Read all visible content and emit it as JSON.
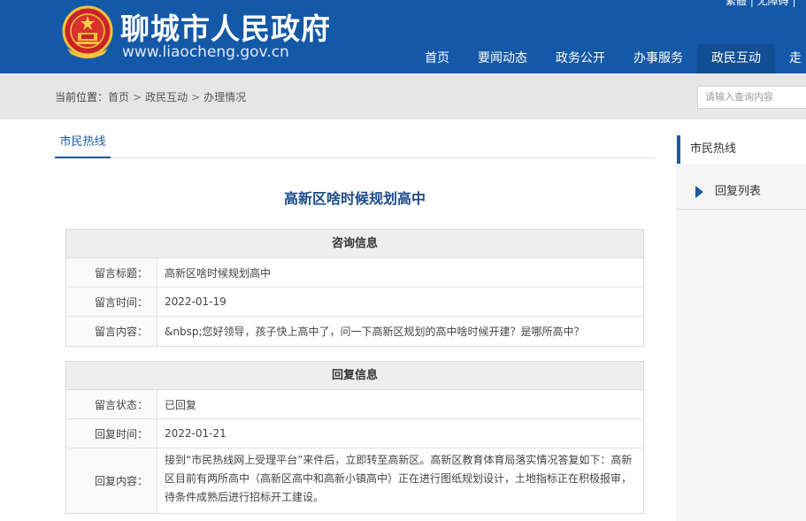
{
  "header": {
    "site_title": "聊城市人民政府",
    "site_url": "www.liaocheng.gov.cn",
    "top_links": "繁體 | 无障碍 |",
    "nav": [
      {
        "label": "首页"
      },
      {
        "label": "要闻动态"
      },
      {
        "label": "政务公开"
      },
      {
        "label": "办事服务"
      },
      {
        "label": "政民互动",
        "active": true
      },
      {
        "label": "走"
      }
    ]
  },
  "breadcrumb": {
    "prefix": "当前位置：",
    "items": [
      "首页",
      "政民互动",
      "办理情况"
    ],
    "sep": ">"
  },
  "search": {
    "placeholder": "请输入查询内容"
  },
  "tab": {
    "label": "市民热线"
  },
  "page_title": "高新区啥时候规划高中",
  "consult": {
    "heading": "咨询信息",
    "rows": [
      {
        "label": "留言标题：",
        "value": "高新区啥时候规划高中"
      },
      {
        "label": "留言时间：",
        "value": "2022-01-19"
      },
      {
        "label": "留言内容：",
        "value": "&nbsp;您好领导，孩子快上高中了，问一下高新区规划的高中啥时候开建？是哪所高中？"
      }
    ]
  },
  "reply": {
    "heading": "回复信息",
    "rows": [
      {
        "label": "留言状态：",
        "value": "已回复"
      },
      {
        "label": "回复时间：",
        "value": "2022-01-21"
      },
      {
        "label": "回复内容：",
        "value": "接到“市民热线网上受理平台”来件后，立即转至高新区。高新区教育体育局落实情况答复如下：高新区目前有两所高中（高新区高中和高新小镇高中）正在进行图纸规划设计，土地指标正在积极报审，待条件成熟后进行招标开工建设。"
      }
    ]
  },
  "sidebar": {
    "heading": "市民热线",
    "items": [
      {
        "label": "回复列表"
      }
    ]
  },
  "colors": {
    "header_bg": "#1458a8",
    "accent": "#1d5aa0"
  }
}
